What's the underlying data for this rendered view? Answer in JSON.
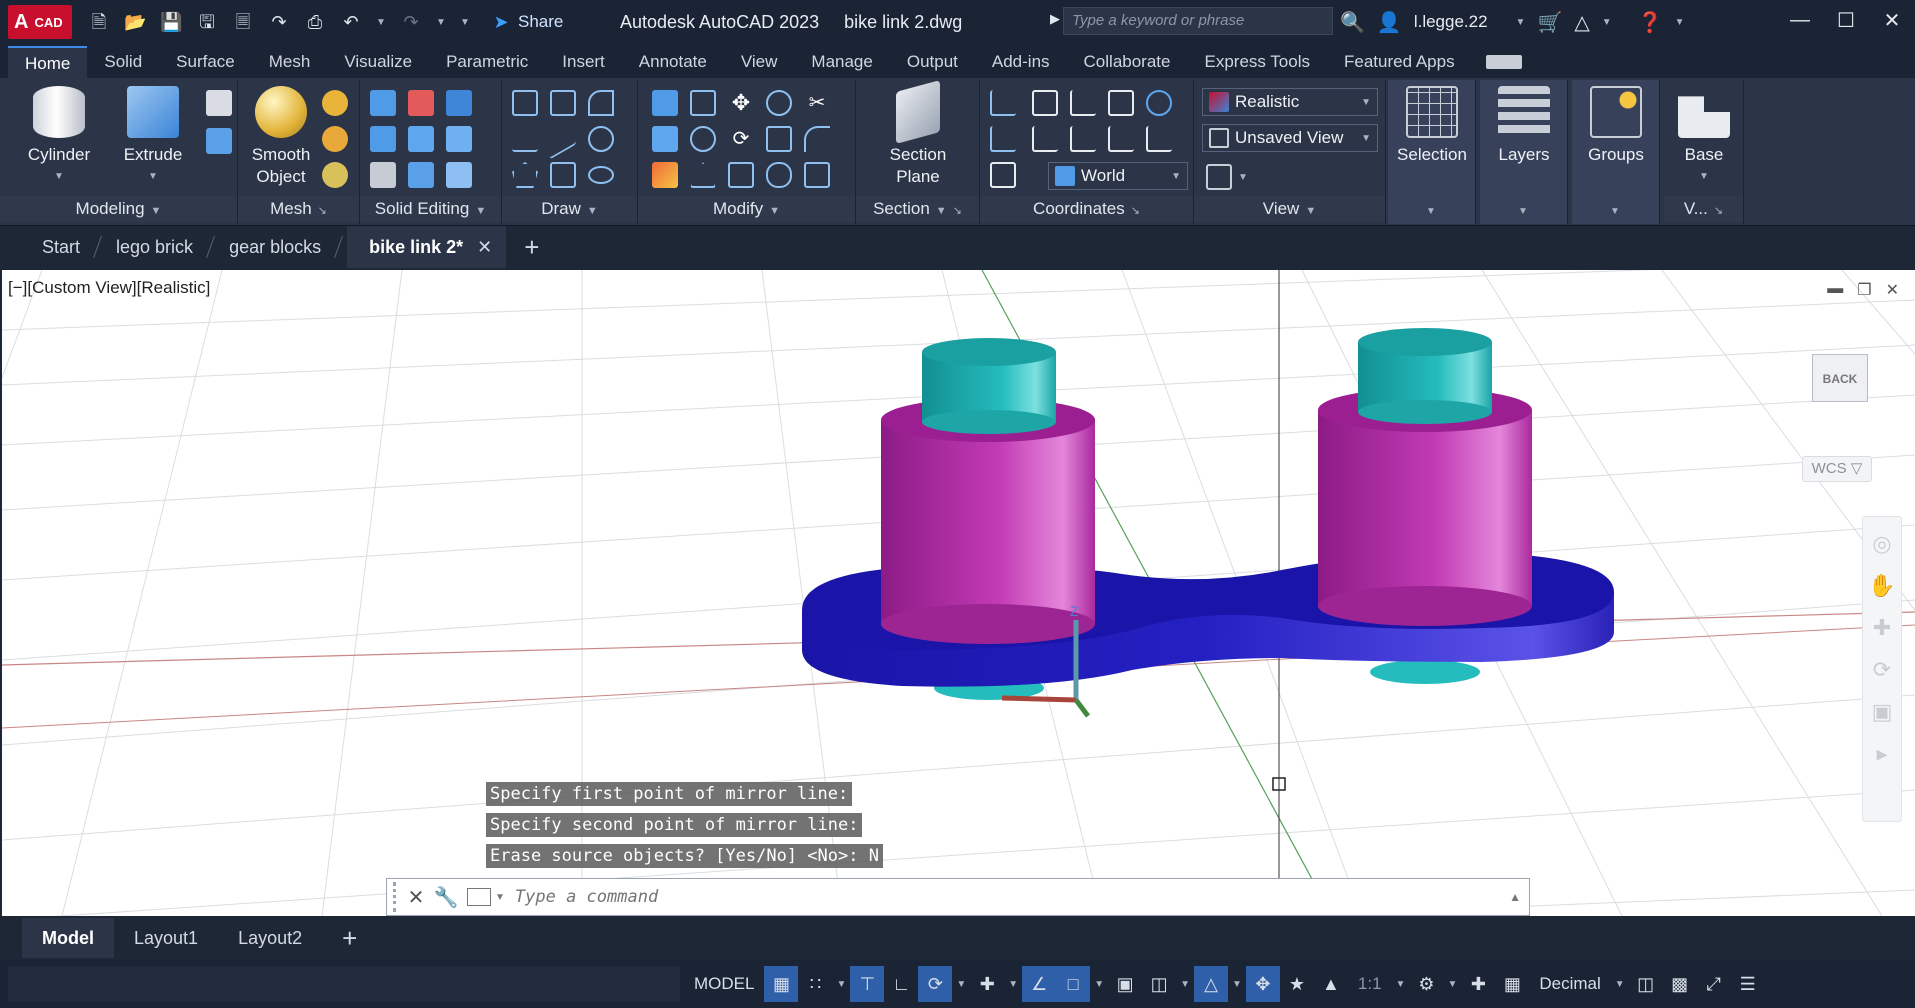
{
  "app": {
    "logo_letter": "A",
    "logo_text": "CAD",
    "title": "Autodesk AutoCAD 2023",
    "file": "bike link 2.dwg",
    "share_label": "Share",
    "search_placeholder": "Type a keyword or phrase",
    "user": "l.legge.22"
  },
  "ribbon_tabs": [
    "Home",
    "Solid",
    "Surface",
    "Mesh",
    "Visualize",
    "Parametric",
    "Insert",
    "Annotate",
    "View",
    "Manage",
    "Output",
    "Add-ins",
    "Collaborate",
    "Express Tools",
    "Featured Apps"
  ],
  "ribbon": {
    "cylinder": "Cylinder",
    "extrude": "Extrude",
    "smooth_object": [
      "Smooth",
      "Object"
    ],
    "section_plane": [
      "Section",
      "Plane"
    ],
    "visual_style": "Realistic",
    "named_view": "Unsaved View",
    "ucs": "World",
    "selection": "Selection",
    "layers": "Layers",
    "groups": "Groups",
    "base": "Base",
    "panels": {
      "modeling": "Modeling",
      "mesh": "Mesh",
      "solid_editing": "Solid Editing",
      "draw": "Draw",
      "modify": "Modify",
      "section": "Section",
      "coordinates": "Coordinates",
      "view": "View",
      "v_truncated": "V..."
    }
  },
  "file_tabs": [
    "Start",
    "lego brick",
    "gear blocks",
    "bike link 2*"
  ],
  "viewport": {
    "label": "[−][Custom View][Realistic]",
    "viewcube_face": "BACK",
    "wcs": "WCS",
    "command_history": [
      "Specify first point of mirror line:",
      "Specify second point of mirror line:",
      "Erase source objects? [Yes/No] <No>: N"
    ],
    "command_placeholder": "Type a command"
  },
  "layout_tabs": [
    "Model",
    "Layout1",
    "Layout2"
  ],
  "status": {
    "model": "MODEL",
    "scale": "1:1",
    "units": "Decimal"
  },
  "colors": {
    "ribbon_bg": "#2b3547",
    "title_bg": "#1b2434",
    "accent": "#3c8ce7",
    "link_plate": "#1a14a8",
    "boss": "#b0269f",
    "pin": "#1fa8aa"
  }
}
